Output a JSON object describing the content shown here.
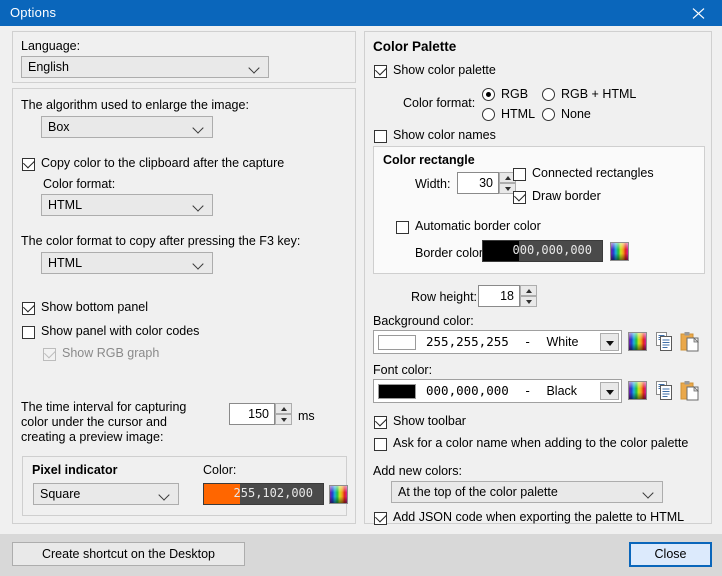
{
  "window": {
    "title": "Options",
    "close_icon": "close-icon"
  },
  "left": {
    "language": {
      "label": "Language:",
      "value": "English"
    },
    "algorithm": {
      "label": "The algorithm used to enlarge the image:",
      "value": "Box"
    },
    "copy_color": {
      "label": "Copy color to the clipboard after the capture",
      "checked": true,
      "format_label": "Color format:",
      "format_value": "HTML"
    },
    "f3_format": {
      "label": "The color format to copy after pressing the F3 key:",
      "value": "HTML"
    },
    "show_bottom_panel": {
      "label": "Show bottom panel",
      "checked": true
    },
    "show_color_codes_panel": {
      "label": "Show panel with color codes",
      "checked": false
    },
    "show_rgb_graph": {
      "label": "Show RGB graph",
      "checked": true,
      "disabled": true
    },
    "interval": {
      "label_line1": "The time interval for capturing",
      "label_line2": "color under the cursor and",
      "label_line3": "creating a preview image:",
      "value": "150",
      "unit": "ms"
    },
    "pixel_indicator": {
      "title": "Pixel indicator",
      "shape": "Square",
      "color_label": "Color:",
      "color_value": "255,102,000",
      "color_hex": "#ff6600",
      "picker_icon": "rainbow-picker-icon"
    },
    "shortcut_button": "Create shortcut on the Desktop"
  },
  "right": {
    "title": "Color Palette",
    "show_palette": {
      "label": "Show color palette",
      "checked": true
    },
    "color_format": {
      "label": "Color format:",
      "options": [
        "RGB",
        "RGB + HTML",
        "HTML",
        "None"
      ],
      "selected": "RGB"
    },
    "show_color_names": {
      "label": "Show color names",
      "checked": false
    },
    "color_rectangle": {
      "title": "Color rectangle",
      "width_label": "Width:",
      "width_value": "30",
      "connected": {
        "label": "Connected rectangles",
        "checked": false
      },
      "draw_border": {
        "label": "Draw border",
        "checked": true
      },
      "automatic_border": {
        "label": "Automatic border color",
        "checked": false
      },
      "border_color_label": "Border color:",
      "border_color_value": "000,000,000",
      "border_color_hex": "#000000",
      "picker_icon": "rainbow-picker-icon"
    },
    "row_height": {
      "label": "Row height:",
      "value": "18"
    },
    "background_color": {
      "label": "Background color:",
      "value": "255,255,255",
      "dash": "-",
      "name": "White",
      "hex": "#ffffff",
      "picker_icon": "rainbow-picker-icon",
      "copy_icon": "copy-icon",
      "paste_icon": "paste-icon"
    },
    "font_color": {
      "label": "Font color:",
      "value": "000,000,000",
      "dash": "-",
      "name": "Black",
      "hex": "#000000",
      "picker_icon": "rainbow-picker-icon",
      "copy_icon": "copy-icon",
      "paste_icon": "paste-icon"
    },
    "show_toolbar": {
      "label": "Show toolbar",
      "checked": true
    },
    "ask_color_name": {
      "label": "Ask for a color name when adding to the color palette",
      "checked": false
    },
    "add_new_colors": {
      "label": "Add new colors:",
      "value": "At the top of the color palette"
    },
    "add_json": {
      "label": "Add JSON code when exporting the palette to HTML",
      "checked": true
    }
  },
  "footer": {
    "close_button": "Close"
  },
  "colors": {
    "titlebar": "#0a66bb",
    "accent": "#0a66bb",
    "panel": "#f0f0f0",
    "footer": "#d8d8d8"
  }
}
